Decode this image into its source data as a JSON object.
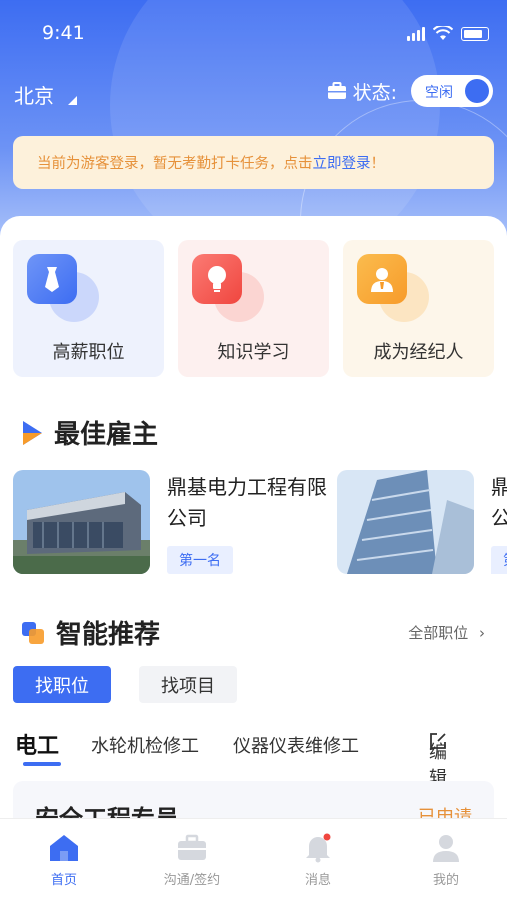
{
  "status_bar": {
    "time": "9:41"
  },
  "header": {
    "city": "北京",
    "status_label": "状态:",
    "status_value": "空闲",
    "notice_text": "当前为游客登录，暂无考勤打卡任务，点击 ",
    "notice_link": "立即登录",
    "notice_end": "！"
  },
  "quick_cards": [
    {
      "label": "高薪职位",
      "icon": "tie-icon"
    },
    {
      "label": "知识学习",
      "icon": "lightbulb-icon"
    },
    {
      "label": "成为经纪人",
      "icon": "agent-icon"
    }
  ],
  "best_employers": {
    "title": "最佳雇主",
    "items": [
      {
        "name": "鼎基电力工程有限公司",
        "rank": "第一名"
      },
      {
        "name": "鼎基电力工程有限公司",
        "rank": "第二名"
      }
    ]
  },
  "recommend": {
    "title": "智能推荐",
    "more_label": "全部职位",
    "tabs": [
      "找职位",
      "找项目"
    ],
    "categories": [
      "电工",
      "水轮机检修工",
      "仪器仪表维修工"
    ],
    "edit_label": "编辑"
  },
  "job_card": {
    "title": "安全工程专员",
    "status": "已申请"
  },
  "tabbar": [
    "首页",
    "沟通/签约",
    "消息",
    "我的"
  ],
  "colors": {
    "primary": "#3d6df2",
    "orange": "#e6913a"
  }
}
